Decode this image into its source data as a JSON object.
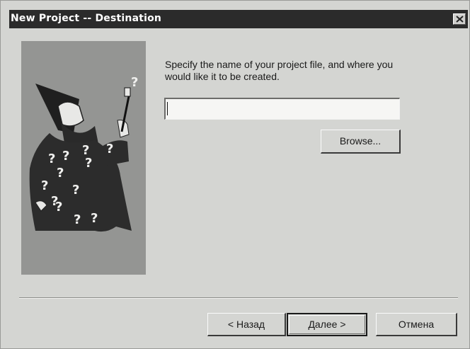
{
  "window": {
    "title": "New Project -- Destination",
    "close_icon": "close-icon"
  },
  "wizard": {
    "image": "wizard-illustration",
    "marks": [
      "?",
      "?",
      "?",
      "?",
      "?",
      "?",
      "?",
      "?",
      "?",
      "?",
      "?",
      "?",
      "?"
    ]
  },
  "content": {
    "instruction": "Specify the name of your project file, and where you would like it to be created.",
    "project_name_value": "",
    "project_name_placeholder": "",
    "browse_label": "Browse..."
  },
  "footer": {
    "back_label": "< Назад",
    "next_label": "Далее >",
    "cancel_label": "Отмена"
  }
}
